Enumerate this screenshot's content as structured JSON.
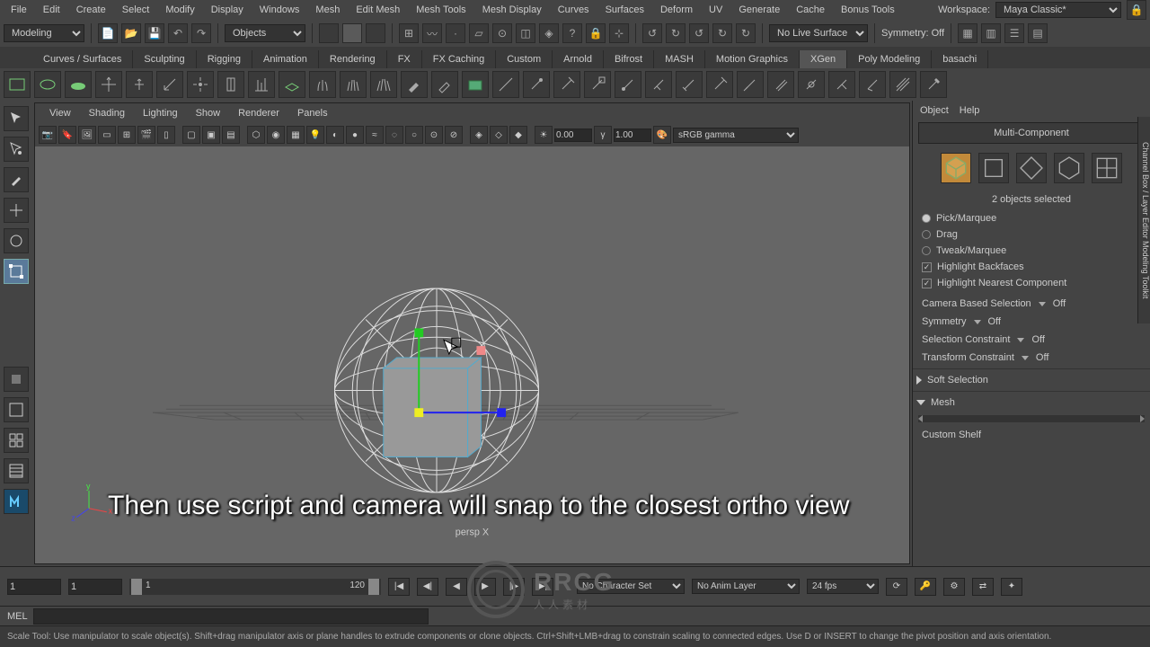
{
  "menubar": [
    "File",
    "Edit",
    "Create",
    "Select",
    "Modify",
    "Display",
    "Windows",
    "Mesh",
    "Edit Mesh",
    "Mesh Tools",
    "Mesh Display",
    "Curves",
    "Surfaces",
    "Deform",
    "UV",
    "Generate",
    "Cache",
    "Bonus Tools"
  ],
  "workspace_label": "Workspace:",
  "workspace_value": "Maya Classic*",
  "mode_dropdown": "Modeling",
  "objects_dropdown": "Objects",
  "live_surface": "No Live Surface",
  "symmetry_label": "Symmetry: Off",
  "tabs": [
    "Curves / Surfaces",
    "Sculpting",
    "Rigging",
    "Animation",
    "Rendering",
    "FX",
    "FX Caching",
    "Custom",
    "Arnold",
    "Bifrost",
    "MASH",
    "Motion Graphics",
    "XGen",
    "Poly Modeling",
    "basachi"
  ],
  "active_tab": "XGen",
  "vp_menus": [
    "View",
    "Shading",
    "Lighting",
    "Show",
    "Renderer",
    "Panels"
  ],
  "vp_time_a": "0.00",
  "vp_time_b": "1.00",
  "vp_colorspace": "sRGB gamma",
  "persp_label": "persp X",
  "rp_menus": [
    "Object",
    "Help"
  ],
  "multi_component": "Multi-Component",
  "selection_msg": "2 objects selected",
  "sel_modes": [
    "Pick/Marquee",
    "Drag",
    "Tweak/Marquee"
  ],
  "sel_mode_active": 0,
  "checks": [
    {
      "label": "Highlight Backfaces",
      "on": true
    },
    {
      "label": "Highlight Nearest Component",
      "on": true
    }
  ],
  "dd_rows": [
    {
      "label": "Camera Based Selection",
      "value": "Off"
    },
    {
      "label": "Symmetry",
      "value": "Off"
    },
    {
      "label": "Selection Constraint",
      "value": "Off"
    },
    {
      "label": "Transform Constraint",
      "value": "Off"
    }
  ],
  "soft_selection": "Soft Selection",
  "mesh_section": "Mesh",
  "custom_shelf": "Custom Shelf",
  "right_vert_tab": "Channel Box / Layer Editor       Modeling Toolkit",
  "timeline": {
    "start_frame": "1",
    "range_start": "1",
    "range_end_label": "120",
    "range_start_label": "1",
    "char_set": "No Character Set",
    "anim_layer": "No Anim Layer",
    "fps": "24 fps"
  },
  "cmd_lang": "MEL",
  "status_text": "Scale Tool: Use manipulator to scale object(s). Shift+drag manipulator axis or plane handles to extrude components or clone objects. Ctrl+Shift+LMB+drag to constrain scaling to connected edges. Use D or INSERT to change the pivot position and axis orientation.",
  "caption_text": "Then use script and camera will snap to the closest ortho view",
  "logo": {
    "big": "RRCG",
    "sm": "人人素材"
  }
}
